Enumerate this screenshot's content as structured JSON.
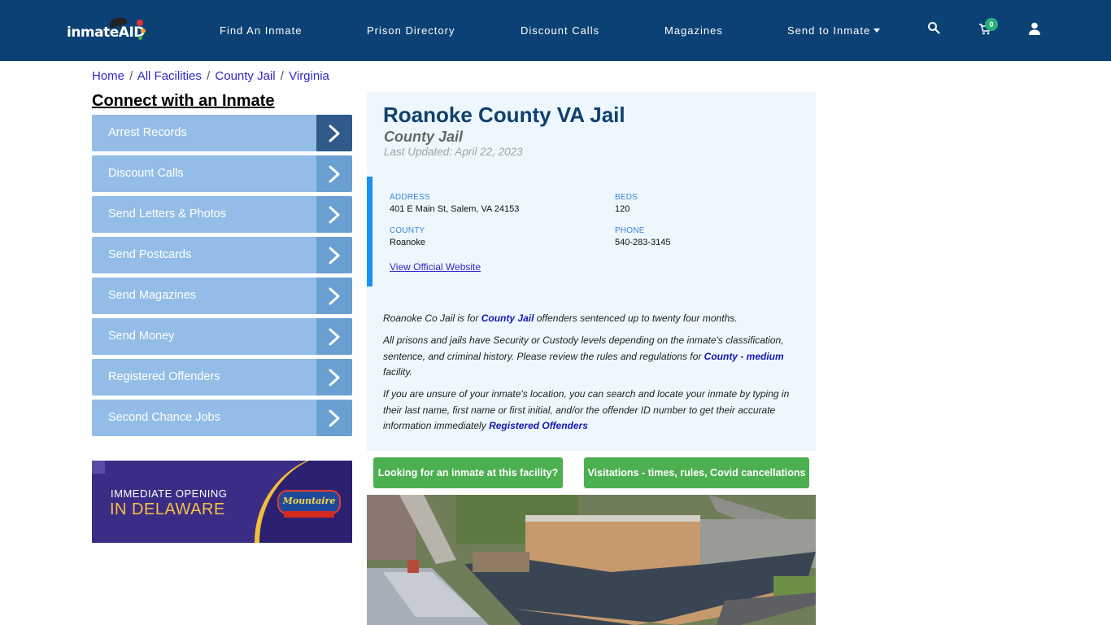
{
  "brand": {
    "logo_text": "inmate",
    "logo_accent": "AID"
  },
  "nav": {
    "items": [
      {
        "label": "Find An Inmate"
      },
      {
        "label": "Prison Directory"
      },
      {
        "label": "Discount Calls"
      },
      {
        "label": "Magazines"
      },
      {
        "label": "Send to Inmate",
        "has_dropdown": true
      }
    ],
    "icons": [
      "search-icon",
      "cart-icon",
      "user-icon"
    ],
    "cart_count": "0"
  },
  "breadcrumb": [
    {
      "label": "Home"
    },
    {
      "label": "All Facilities"
    },
    {
      "label": "County Jail"
    },
    {
      "label": "Virginia"
    }
  ],
  "breadcrumb_sep": "/",
  "sidebar": {
    "title": "Connect with an Inmate",
    "items": [
      {
        "label": "Arrest Records",
        "active": true
      },
      {
        "label": "Discount Calls"
      },
      {
        "label": "Send Letters & Photos"
      },
      {
        "label": "Send Postcards"
      },
      {
        "label": "Send Magazines"
      },
      {
        "label": "Send Money"
      },
      {
        "label": "Registered Offenders"
      },
      {
        "label": "Second Chance Jobs"
      }
    ],
    "ad": {
      "line1": "IMMEDIATE OPENING",
      "line2": "IN DELAWARE",
      "brand": "Mountaire"
    }
  },
  "facility": {
    "title": "Roanoke County VA Jail",
    "type": "County Jail",
    "last_updated": "Last Updated: April 22, 2023",
    "info": {
      "address_label": "ADDRESS",
      "address": "401 E Main St, Salem, VA 24153",
      "beds_label": "BEDS",
      "beds": "120",
      "county_label": "COUNTY",
      "county": "Roanoke",
      "phone_label": "PHONE",
      "phone": "540-283-3145",
      "website_link": "View Official Website"
    },
    "description": {
      "p1_pre": "Roanoke Co Jail is for ",
      "p1_link": "County Jail",
      "p1_post": " offenders sentenced up to twenty four months.",
      "p2_pre": "All prisons and jails have Security or Custody levels depending on the inmate's classification, sentence, and criminal history. Please review the rules and regulations for ",
      "p2_link": "County - medium",
      "p2_post": " facility.",
      "p3_pre": "If you are unsure of your inmate's location, you can search and locate your inmate by typing in their last name, first name or first initial, and/or the offender ID number to get their accurate information immediately ",
      "p3_link": "Registered Offenders"
    }
  },
  "actions": {
    "find_inmate": "Looking for an inmate at this facility?",
    "visitation": "Visitations - times, rules, Covid cancellations"
  },
  "colors": {
    "nav_bg": "#0b4174",
    "sidebar_item": "#93bde6",
    "sidebar_arrow": "#6a9fd2",
    "sidebar_arrow_active": "#2f5a8a",
    "card_bg": "#edf7fd",
    "accent_bar": "#1693ee",
    "green_button": "#4caf50",
    "title": "#10406e",
    "link": "#2f27c9"
  }
}
